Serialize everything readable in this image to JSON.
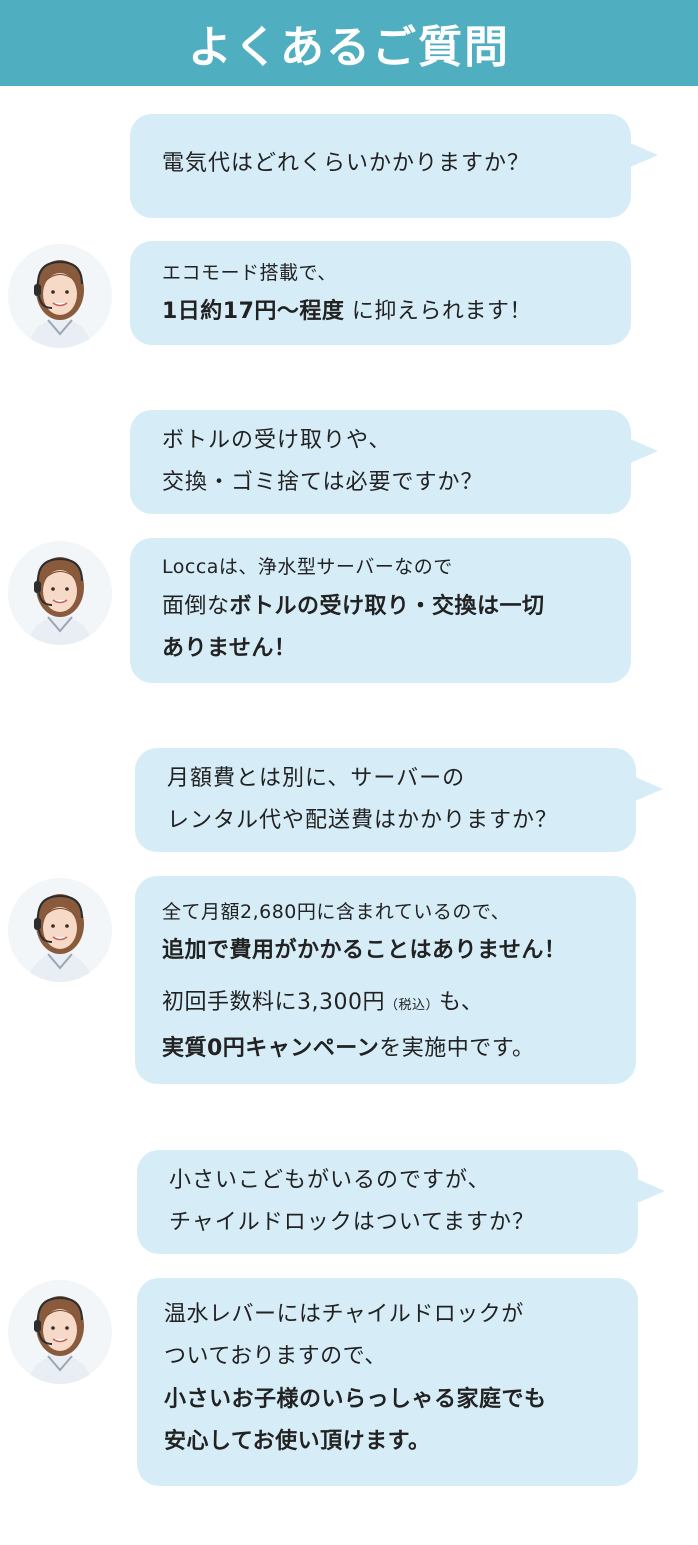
{
  "page_title": "よくあるご質問",
  "faq": [
    {
      "question": [
        "電気代はどれくらいかかりますか？"
      ],
      "answer": {
        "intro": "エコモード搭載で、",
        "line2_bold": "1日約17円〜程度",
        "line2_rest": " に抑えられます！"
      }
    },
    {
      "question": [
        "ボトルの受け取りや、",
        "交換・ゴミ捨ては必要ですか？"
      ],
      "answer": {
        "intro": "Loccaは、浄水型サーバーなので",
        "line2_plain": "面倒な",
        "line2_bold": "ボトルの受け取り・交換は一切",
        "line3_bold": "ありません！"
      }
    },
    {
      "question": [
        "月額費とは別に、サーバーの",
        "レンタル代や配送費はかかりますか？"
      ],
      "answer": {
        "intro": "全て月額2,680円に含まれているので、",
        "line2_bold": "追加で費用がかかることはありません！",
        "line3_plain": "初回手数料に3,300円",
        "line3_small": "（税込）",
        "line3_end": "も、",
        "line4_bold": "実質0円キャンペーン",
        "line4_rest": "を実施中です。"
      }
    },
    {
      "question": [
        "小さいこどもがいるのですが、",
        "チャイルドロックはついてますか？"
      ],
      "answer": {
        "line1": "温水レバーにはチャイルドロックが",
        "line2": "ついておりますので、",
        "line3_bold": "小さいお子様のいらっしゃる家庭でも",
        "line4_bold": "安心してお使い頂けます。"
      }
    }
  ],
  "colors": {
    "header_bg": "#4faebf",
    "bubble_bg": "#d6edf8",
    "text": "#222222"
  },
  "icons": {
    "avatar": "support-operator-avatar"
  }
}
